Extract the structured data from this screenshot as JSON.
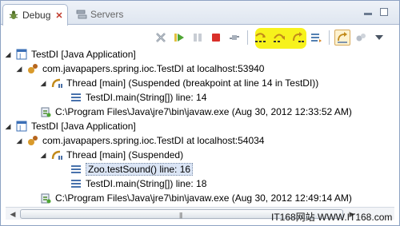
{
  "tabs": [
    {
      "label": "Debug",
      "active": true,
      "close": "✕"
    },
    {
      "label": "Servers",
      "active": false
    }
  ],
  "toolbar": {
    "buttons": [
      "remove-all-terminated",
      "resume",
      "suspend",
      "terminate",
      "disconnect",
      "step-into",
      "step-over",
      "step-return",
      "drop-to-frame",
      "use-step-filters",
      "view-menu"
    ],
    "highlight_color": "#f7f21c"
  },
  "tree": {
    "launch1": "TestDI [Java Application]",
    "vm1": "com.javapapers.spring.ioc.TestDI at localhost:53940",
    "thread1": "Thread [main] (Suspended (breakpoint at line 14 in TestDI))",
    "frame1a": "TestDI.main(String[]) line: 14",
    "process1": "C:\\Program Files\\Java\\jre7\\bin\\javaw.exe (Aug 30, 2012 12:33:52 AM)",
    "launch2": "TestDI [Java Application]",
    "vm2": "com.javapapers.spring.ioc.TestDI at localhost:54034",
    "thread2": "Thread [main] (Suspended)",
    "frame2a": "Zoo.testSound() line: 16",
    "frame2b": "TestDI.main(String[]) line: 18",
    "process2": "C:\\Program Files\\Java\\jre7\\bin\\javaw.exe (Aug 30, 2012 12:49:14 AM)"
  },
  "scrollbar": {
    "left_arrow": "◀",
    "right_arrow": "▶",
    "grip": "|||"
  },
  "watermark": "IT168网站 WWW.IT168.com"
}
